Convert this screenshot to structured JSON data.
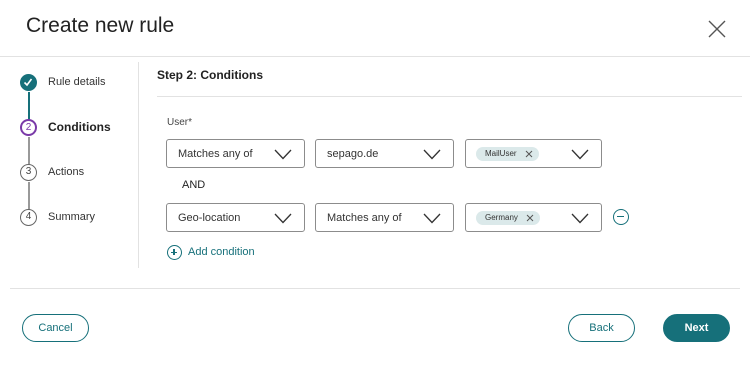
{
  "dialog": {
    "title": "Create new rule"
  },
  "stepper": [
    {
      "number": "1",
      "label": "Rule details",
      "state": "done"
    },
    {
      "number": "2",
      "label": "Conditions",
      "state": "active"
    },
    {
      "number": "3",
      "label": "Actions",
      "state": "pending"
    },
    {
      "number": "4",
      "label": "Summary",
      "state": "pending"
    }
  ],
  "main": {
    "heading": "Step 2: Conditions",
    "field_label": "User*",
    "conditions": [
      {
        "attribute": "Matches any of",
        "operator": "sepago.de",
        "value_chip": "MailUser"
      },
      {
        "attribute": "Geo-location",
        "operator": "Matches any of",
        "value_chip": "Germany"
      }
    ],
    "joiner": "AND",
    "add_condition_label": "Add condition"
  },
  "footer": {
    "cancel_label": "Cancel",
    "back_label": "Back",
    "next_label": "Next"
  },
  "colors": {
    "accent": "#16707a",
    "active_step": "#7a3aa8",
    "chip_bg": "#dbe9ea"
  }
}
